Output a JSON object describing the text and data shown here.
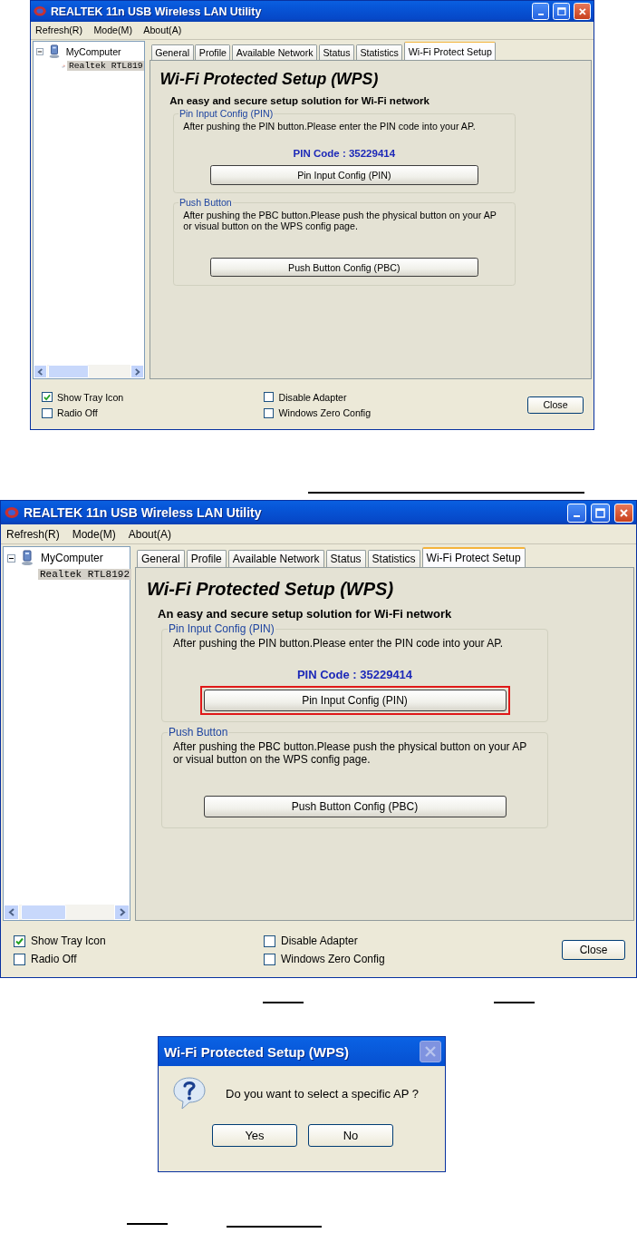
{
  "utility_windows": [
    {
      "title": "REALTEK 11n USB Wireless LAN Utility",
      "menu": [
        "Refresh(R)",
        "Mode(M)",
        "About(A)"
      ],
      "tree": [
        {
          "label": "MyComputer",
          "expanded": true,
          "children": [
            {
              "label": "Realtek RTL819",
              "selected": true
            }
          ]
        }
      ],
      "tabs": [
        {
          "label": "General",
          "selected": false
        },
        {
          "label": "Profile",
          "selected": false
        },
        {
          "label": "Available Network",
          "selected": false
        },
        {
          "label": "Status",
          "selected": false
        },
        {
          "label": "Statistics",
          "selected": false
        },
        {
          "label": "Wi-Fi Protect Setup",
          "selected": true
        }
      ],
      "wps": {
        "heading": "Wi-Fi Protected Setup (WPS)",
        "subheading": "An easy and secure setup solution for Wi-Fi network",
        "groups": [
          {
            "legend": "Pin Input Config (PIN)",
            "description_lines": [
              "After pushing the PIN button.Please enter the PIN code into your AP."
            ],
            "pin_code": "PIN Code :  35229414",
            "button": {
              "label": "Pin Input Config (PIN)",
              "highlighted": false
            }
          },
          {
            "legend": "Push Button",
            "description_lines": [
              "After pushing the PBC button.Please push the physical button on your AP",
              "or visual button on the WPS config page."
            ],
            "button": {
              "label": "Push Button Config (PBC)",
              "highlighted": false
            }
          }
        ]
      },
      "options": [
        {
          "label": "Show Tray Icon",
          "checked": true
        },
        {
          "label": "Radio Off",
          "checked": false
        },
        {
          "label": "Disable Adapter",
          "checked": false
        },
        {
          "label": "Windows Zero Config",
          "checked": false
        }
      ],
      "close_button": "Close"
    },
    {
      "title": "REALTEK 11n USB Wireless LAN Utility",
      "menu": [
        "Refresh(R)",
        "Mode(M)",
        "About(A)"
      ],
      "tree": [
        {
          "label": "MyComputer",
          "expanded": true,
          "children": [
            {
              "label": "Realtek RTL8192",
              "selected": true
            }
          ]
        }
      ],
      "tabs": [
        {
          "label": "General",
          "selected": false
        },
        {
          "label": "Profile",
          "selected": false
        },
        {
          "label": "Available Network",
          "selected": false
        },
        {
          "label": "Status",
          "selected": false
        },
        {
          "label": "Statistics",
          "selected": false
        },
        {
          "label": "Wi-Fi Protect Setup",
          "selected": true
        }
      ],
      "wps": {
        "heading": "Wi-Fi Protected Setup (WPS)",
        "subheading": "An easy and secure setup solution for Wi-Fi network",
        "groups": [
          {
            "legend": "Pin Input Config (PIN)",
            "description_lines": [
              "After pushing the PIN button.Please enter the PIN code into your AP."
            ],
            "pin_code": "PIN Code :  35229414",
            "button": {
              "label": "Pin Input Config (PIN)",
              "highlighted": true
            }
          },
          {
            "legend": "Push Button",
            "description_lines": [
              "After pushing the PBC button.Please push the physical button on your AP",
              "or visual button on the WPS config page."
            ],
            "button": {
              "label": "Push Button Config (PBC)",
              "highlighted": false
            }
          }
        ]
      },
      "options": [
        {
          "label": "Show Tray Icon",
          "checked": true
        },
        {
          "label": "Radio Off",
          "checked": false
        },
        {
          "label": "Disable Adapter",
          "checked": false
        },
        {
          "label": "Windows Zero Config",
          "checked": false
        }
      ],
      "close_button": "Close"
    }
  ],
  "dialog": {
    "title": "Wi-Fi Protected Setup (WPS)",
    "close_disabled": true,
    "message": "Do you want to select a specific AP ?",
    "buttons": [
      "Yes",
      "No"
    ]
  }
}
